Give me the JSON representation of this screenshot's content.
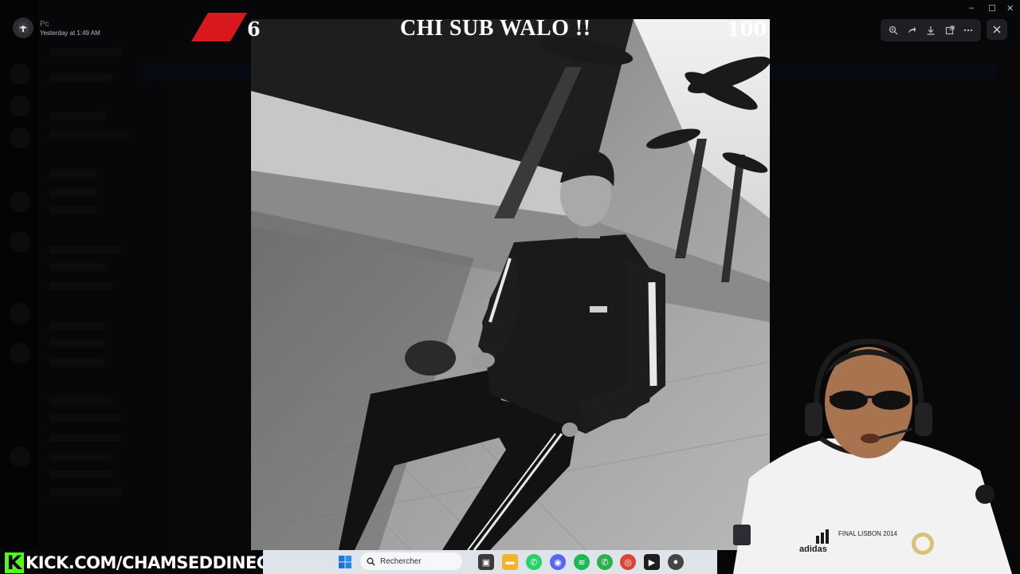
{
  "viewer": {
    "user": "Pc",
    "timestamp": "Yesterday at 1:49 AM"
  },
  "toolbar": {
    "zoom": "zoom-in-icon",
    "forward": "forward-icon",
    "download": "download-icon",
    "open": "open-external-icon",
    "more": "more-icon",
    "close": "close-icon"
  },
  "window_controls": {
    "minimize": "–",
    "maximize": "☐",
    "close": "✕"
  },
  "banner": {
    "left_count": "6",
    "title": "CHI SUB WALO !!",
    "right_count": "100",
    "accent": "#d8181c"
  },
  "kick": {
    "logo": "K",
    "text": "KICK.COM/CHAMSEDDINECH",
    "accent": "#53fc18"
  },
  "jersey": {
    "brand": "adidas",
    "text": "FINAL LISBON 2014"
  },
  "taskbar": {
    "search_placeholder": "Rechercher"
  }
}
